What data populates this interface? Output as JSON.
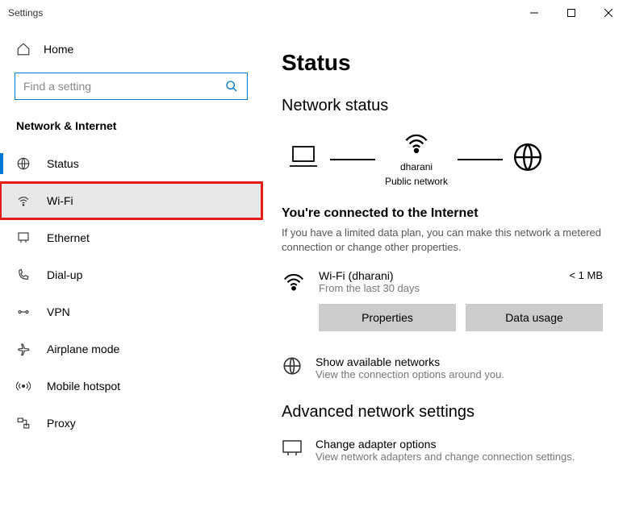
{
  "window": {
    "title": "Settings"
  },
  "sidebar": {
    "home": "Home",
    "search_placeholder": "Find a setting",
    "category": "Network & Internet",
    "items": [
      {
        "label": "Status"
      },
      {
        "label": "Wi-Fi"
      },
      {
        "label": "Ethernet"
      },
      {
        "label": "Dial-up"
      },
      {
        "label": "VPN"
      },
      {
        "label": "Airplane mode"
      },
      {
        "label": "Mobile hotspot"
      },
      {
        "label": "Proxy"
      }
    ]
  },
  "main": {
    "title": "Status",
    "status_heading": "Network status",
    "diagram": {
      "ssid": "dharani",
      "type": "Public network"
    },
    "connected_title": "You're connected to the Internet",
    "connected_desc": "If you have a limited data plan, you can make this network a metered connection or change other properties.",
    "wifi": {
      "name": "Wi-Fi (dharani)",
      "sub": "From the last 30 days",
      "usage": "< 1 MB"
    },
    "buttons": {
      "properties": "Properties",
      "data_usage": "Data usage"
    },
    "available": {
      "title": "Show available networks",
      "sub": "View the connection options around you."
    },
    "advanced_heading": "Advanced network settings",
    "adapter": {
      "title": "Change adapter options",
      "sub": "View network adapters and change connection settings."
    }
  }
}
